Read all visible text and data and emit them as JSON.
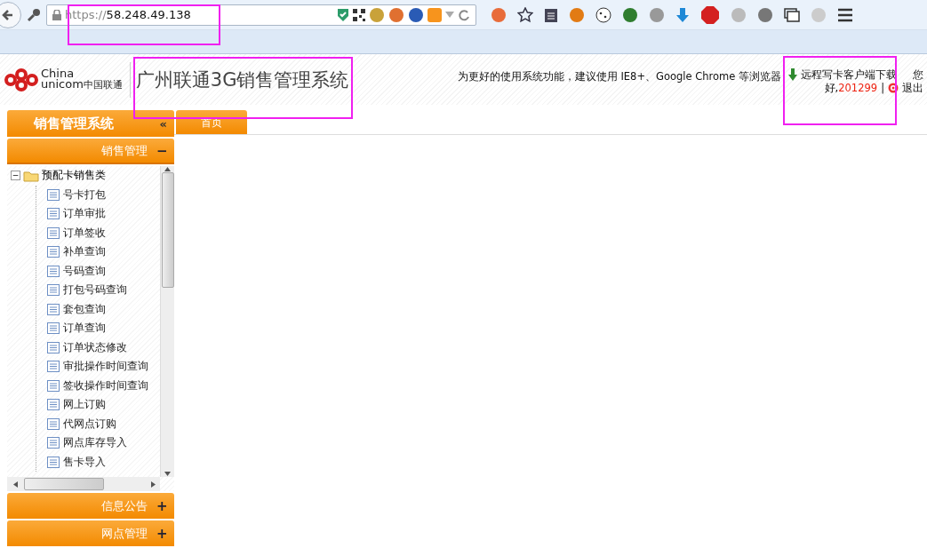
{
  "browser": {
    "url_scheme": "https://",
    "url_host": "58.248.49.138",
    "url_highlighted": true
  },
  "header": {
    "logo_latin_1": "China",
    "logo_latin_2": "unicom",
    "logo_cn": "中国联通",
    "title": "广州联通3G销售管理系统",
    "title_highlighted": true,
    "notice": "为更好的使用系统功能，建议使用 IE8+、Google Chrome 等浏览器",
    "download_link": "远程写卡客户端下载",
    "greeting_1": "您",
    "greeting_2": "好,",
    "user": "201299",
    "separator": "|",
    "logout": "退出",
    "user_highlighted": true
  },
  "sidebar": {
    "title": "销售管理系统",
    "collapse": "«",
    "sections": [
      {
        "label": "销售管理",
        "expanded": true,
        "toggle": "−",
        "tree": [
          {
            "label": "预配卡销售类",
            "expanded": true,
            "toggle": "−",
            "children": [
              {
                "label": "号卡打包"
              },
              {
                "label": "订单审批"
              },
              {
                "label": "订单签收"
              },
              {
                "label": "补单查询"
              },
              {
                "label": "号码查询"
              },
              {
                "label": "打包号码查询"
              },
              {
                "label": "套包查询"
              },
              {
                "label": "订单查询"
              },
              {
                "label": "订单状态修改"
              },
              {
                "label": "审批操作时间查询"
              },
              {
                "label": "签收操作时间查询"
              },
              {
                "label": "网上订购"
              },
              {
                "label": "代网点订购"
              },
              {
                "label": "网点库存导入"
              },
              {
                "label": "售卡导入"
              }
            ]
          }
        ]
      },
      {
        "label": "信息公告",
        "expanded": false,
        "toggle": "+"
      },
      {
        "label": "网点管理",
        "expanded": false,
        "toggle": "+"
      }
    ]
  },
  "tabs": [
    {
      "label": "首页",
      "selected": true
    }
  ]
}
